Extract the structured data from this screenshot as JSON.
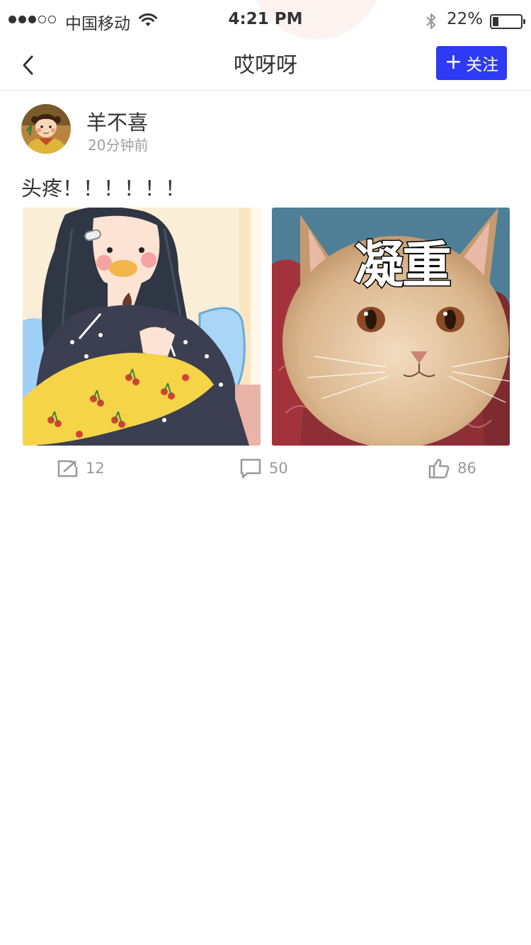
{
  "status_bar": {
    "carrier": "中国移动",
    "time": "4:21 PM",
    "battery_percent_label": "22%",
    "battery_level": 0.22,
    "signal_bars_filled": 3,
    "signal_bars_total": 5
  },
  "nav": {
    "title": "哎呀呀",
    "follow_label": "关注",
    "accent_color": "#2f3af5"
  },
  "post": {
    "username": "羊不喜",
    "time_ago": "20分钟前",
    "text": "头疼！！！！！！",
    "images": [
      {
        "icon": "illustration-girl-eating"
      },
      {
        "icon": "cat-meme",
        "overlay_text": "凝重"
      }
    ],
    "actions": {
      "share_count": "12",
      "comment_count": "50",
      "like_count": "86"
    }
  }
}
